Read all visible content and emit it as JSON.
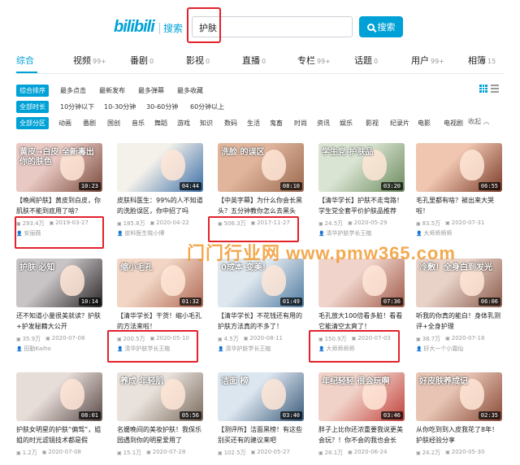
{
  "header": {
    "logo": "bilibili",
    "logo_sub": "搜索",
    "search_value": "护肤",
    "search_button": "搜索"
  },
  "tabs": [
    {
      "label": "综合",
      "count": ""
    },
    {
      "label": "视频",
      "count": "99+"
    },
    {
      "label": "番剧",
      "count": "0"
    },
    {
      "label": "影视",
      "count": "0"
    },
    {
      "label": "直播",
      "count": "0"
    },
    {
      "label": "专栏",
      "count": "99+"
    },
    {
      "label": "话题",
      "count": "0"
    },
    {
      "label": "用户",
      "count": "99+"
    },
    {
      "label": "相簿",
      "count": "15"
    }
  ],
  "filters": {
    "sort": [
      "综合排序",
      "最多点击",
      "最新发布",
      "最多弹幕",
      "最多收藏"
    ],
    "duration": [
      "全部时长",
      "10分钟以下",
      "10-30分钟",
      "30-60分钟",
      "60分钟以上"
    ],
    "zone": [
      "全部分区",
      "动画",
      "番剧",
      "国创",
      "音乐",
      "舞蹈",
      "游戏",
      "知识",
      "数码",
      "生活",
      "鬼畜",
      "时尚",
      "资讯",
      "娱乐",
      "影视",
      "纪录片",
      "电影",
      "电视剧"
    ],
    "collapse": "收起 ︿"
  },
  "videos": [
    {
      "overlay": "黄皮→白皮 全新毒出你的肤色",
      "duration": "10:23",
      "title": "【晚闻护肤】黄皮到白皮，你肌肤不能到底用了啥？",
      "views": "293.4万",
      "date": "2019-03-27",
      "author": "安丽薇",
      "color1": "#e9c9c3",
      "color2": "#7a4a3c"
    },
    {
      "overlay": "",
      "duration": "04:44",
      "title": "皮肤科医生：99%的人不知道的洗脸误区，你中招了吗",
      "views": "185.8万",
      "date": "2020-04-22",
      "author": "皮科医生晓小博",
      "color1": "#f4f1ea",
      "color2": "#3b6ea8"
    },
    {
      "overlay": "洗脸 的误区",
      "duration": "08:10",
      "title": "【中英字幕】为什么你会长黑头？五分钟教你怎么去黑头",
      "views": "506.3万",
      "date": "2017-11-27",
      "author": "",
      "color1": "#e0b59c",
      "color2": "#9a6a50"
    },
    {
      "overlay": "学生党 护肤品",
      "duration": "03:20",
      "title": "【清华学长】护肤不走弯路！学生党全套平价护肤品推荐",
      "views": "24.5万",
      "date": "2020-05-29",
      "author": "清华护肤学长王植",
      "color1": "#d9e4d2",
      "color2": "#6b8a5c"
    },
    {
      "overlay": "",
      "duration": "06:55",
      "title": "毛孔里都有啥？被出来大哭啦！",
      "views": "83.5万",
      "date": "2020-07-31",
      "author": "大师师师师",
      "color1": "#f0c6b0",
      "color2": "#7a3c2a"
    },
    {
      "overlay": "护肤 必知",
      "duration": "10:14",
      "title": "还不知道小量很美就读？护肤+护发秘籍大公开",
      "views": "35.9万",
      "date": "2020-07-08",
      "author": "田勤Kaiho",
      "color1": "#c8c4c6",
      "color2": "#2a2628"
    },
    {
      "overlay": "缩小毛孔",
      "duration": "01:32",
      "title": "【清华学长】干货！缩小毛孔的方法来啦！",
      "views": "200.5万",
      "date": "2020-05-10",
      "author": "清华护肤学长王植",
      "color1": "#f2d5c4",
      "color2": "#b06a55"
    },
    {
      "overlay": "0成本 变美！",
      "duration": "01:49",
      "title": "【清华学长】不花钱还有用的护肤方法真的不多了！",
      "views": "4.5万",
      "date": "2020-08-11",
      "author": "清华护肤学长王植",
      "color1": "#dfe7ee",
      "color2": "#4d7aa0"
    },
    {
      "overlay": "",
      "duration": "07:36",
      "title": "毛孔放大100倍看多脏！看看它能清空太爽了！",
      "views": "150.9万",
      "date": "2020-07-03",
      "author": "大师师师师",
      "color1": "#f0d4cc",
      "color2": "#a05a48"
    },
    {
      "overlay": "冷敷！全身白到发光",
      "duration": "06:06",
      "title": "听我的你真的能白！身体乳测评+全身护理",
      "views": "38.7万",
      "date": "2020-07-18",
      "author": "好大一个小霜仙",
      "color1": "#e8d2c8",
      "color2": "#8a5a4a"
    },
    {
      "overlay": "",
      "duration": "08:01",
      "title": "护肤女明星的护肤“偏驾”，姐姐的时光滤镜技术都是假",
      "views": "1.2万",
      "date": "2020-07-08",
      "author": "",
      "color1": "#e6dcd8",
      "color2": "#5a4a48"
    },
    {
      "overlay": "养成 年轻肌",
      "duration": "05:56",
      "title": "名媛晚间的美妆护肤！我保乐园遇到你的明星爱用了",
      "views": "15.1万",
      "date": "2020-07-28",
      "author": "",
      "color1": "#e9e2dc",
      "color2": "#7a6a5c"
    },
    {
      "overlay": "洁面 榜",
      "duration": "03:40",
      "title": "【测评所】洁面黑榜！有这些别买还有的建议来吧",
      "views": "102.5万",
      "date": "2020-05-27",
      "author": "",
      "color1": "#dce6ef",
      "color2": "#3a5a7a"
    },
    {
      "overlay": "年纪轻轻 很会玩啊",
      "duration": "03:46",
      "title": "胖子上比你还浓重要我说更美会玩？！你不会的我也会长",
      "views": "28.1万",
      "date": "2020-06-24",
      "author": "",
      "color1": "#f1d2c8",
      "color2": "#c0403a"
    },
    {
      "overlay": "好皮肤养成记",
      "duration": "02:35",
      "title": "从你吃到到入皮我花了8年！护肤经验分享",
      "views": "24.2万",
      "date": "2020-05-30",
      "author": "",
      "color1": "#e7c4b4",
      "color2": "#8a4a38"
    }
  ],
  "watermark": "门门行业网 www.pmw365.com"
}
